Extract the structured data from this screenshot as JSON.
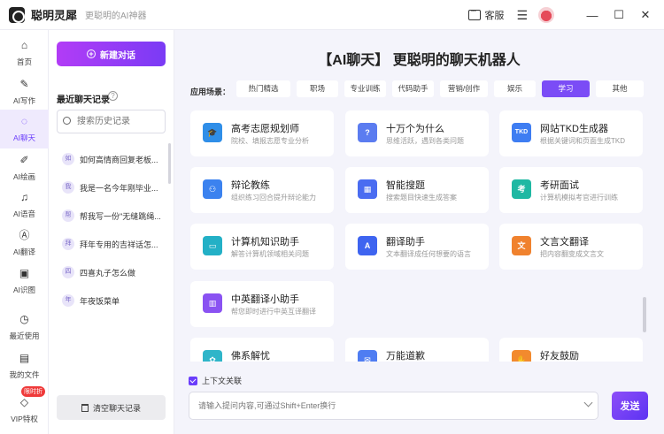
{
  "app": {
    "title": "聪明灵犀",
    "slogan": "更聪明的AI神器",
    "service_label": "客服"
  },
  "nav": [
    {
      "label": "首页",
      "icon": "home-icon",
      "glyph": "⌂"
    },
    {
      "label": "AI写作",
      "icon": "pen-icon",
      "glyph": "✎"
    },
    {
      "label": "AI聊天",
      "icon": "chat-icon",
      "glyph": "◌"
    },
    {
      "label": "AI绘画",
      "icon": "brush-icon",
      "glyph": "✐"
    },
    {
      "label": "AI语音",
      "icon": "headphone-icon",
      "glyph": "♫"
    },
    {
      "label": "AI翻译",
      "icon": "translate-icon",
      "glyph": "Ⓐ"
    },
    {
      "label": "AI识图",
      "icon": "image-scan-icon",
      "glyph": "▣"
    },
    {
      "label": "最近使用",
      "icon": "clock-icon",
      "glyph": "◷"
    },
    {
      "label": "我的文件",
      "icon": "folder-icon",
      "glyph": "▤"
    },
    {
      "label": "VIP特权",
      "icon": "diamond-icon",
      "glyph": "◇"
    }
  ],
  "vip_badge": "限时折",
  "history": {
    "new_chat_label": "新建对话",
    "title": "最近聊天记录",
    "search_placeholder": "搜索历史记录",
    "items": [
      {
        "badge": "如",
        "text": "如何高情商回复老板..."
      },
      {
        "badge": "我",
        "text": "我是一名今年刚毕业..."
      },
      {
        "badge": "帮",
        "text": "帮我写一份\"无缝跳绳..."
      },
      {
        "badge": "拜",
        "text": "拜年专用的吉祥话怎..."
      },
      {
        "badge": "四",
        "text": "四喜丸子怎么做"
      },
      {
        "badge": "年",
        "text": "年夜饭菜单"
      }
    ],
    "clear_label": "清空聊天记录"
  },
  "main": {
    "title": "【AI聊天】 更聪明的聊天机器人",
    "scene_label": "应用场景：",
    "tags": [
      "热门精选",
      "职场",
      "专业训练",
      "代码助手",
      "营销/创作",
      "娱乐",
      "学习",
      "其他"
    ],
    "active_tag": "学习",
    "cards": [
      {
        "title": "高考志愿规划师",
        "desc": "院校、填报志愿专业分析",
        "icon": "graduation-cap-icon",
        "color": "#2f8ee8",
        "glyph": "🎓"
      },
      {
        "title": "十万个为什么",
        "desc": "思维活跃，遇到各类问题",
        "icon": "question-hand-icon",
        "color": "#5b7cf0",
        "glyph": "?"
      },
      {
        "title": "网站TKD生成器",
        "desc": "根据关键词和页面生成TKD",
        "icon": "tkd-icon",
        "color": "#3e7df2",
        "glyph": "TKD"
      },
      {
        "title": "辩论教练",
        "desc": "组织练习回合提升辩论能力",
        "icon": "team-icon",
        "color": "#3b82ef",
        "glyph": "⚇"
      },
      {
        "title": "智能搜题",
        "desc": "搜索题目快速生成答案",
        "icon": "search-book-icon",
        "color": "#4a6cf1",
        "glyph": "▦"
      },
      {
        "title": "考研面试",
        "desc": "计算机模拟考官进行训练",
        "icon": "kao-icon",
        "color": "#1fb8a3",
        "glyph": "考"
      },
      {
        "title": "计算机知识助手",
        "desc": "解答计算机领域相关问题",
        "icon": "monitor-icon",
        "color": "#23b0c6",
        "glyph": "▭"
      },
      {
        "title": "翻译助手",
        "desc": "文本翻译成任何想要的语言",
        "icon": "translate-a-icon",
        "color": "#3e64f0",
        "glyph": "A"
      },
      {
        "title": "文言文翻译",
        "desc": "把内容翻变成文言文",
        "icon": "wen-icon",
        "color": "#f0822e",
        "glyph": "文"
      },
      {
        "title": "中英翻译小助手",
        "desc": "帮您即时进行中英互译翻译",
        "icon": "book-translate-icon",
        "color": "#8a52f2",
        "glyph": "▥"
      },
      {
        "title": "佛系解忧",
        "desc": "",
        "icon": "lotus-icon",
        "color": "#2fb5c9",
        "glyph": "✿"
      },
      {
        "title": "万能道歉",
        "desc": "",
        "icon": "apology-icon",
        "color": "#4f7df2",
        "glyph": "✉"
      },
      {
        "title": "好友鼓励",
        "desc": "",
        "icon": "cheer-icon",
        "color": "#f28a2e",
        "glyph": "✋"
      }
    ],
    "context_label": "上下文关联",
    "input_placeholder": "请输入提问内容,可通过Shift+Enter换行",
    "send_label": "发送"
  }
}
